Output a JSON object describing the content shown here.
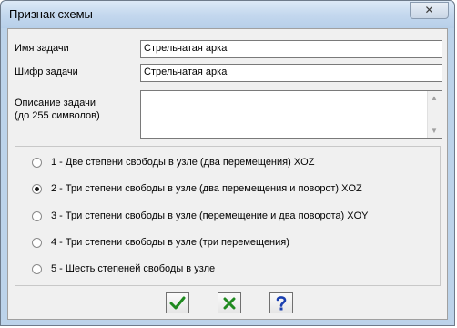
{
  "window": {
    "title": "Признак схемы",
    "close_glyph": "✕"
  },
  "form": {
    "task_name": {
      "label": "Имя задачи",
      "value": "Стрельчатая арка"
    },
    "task_code": {
      "label": "Шифр задачи",
      "value": "Стрельчатая арка"
    },
    "task_description": {
      "label_line1": "Описание задачи",
      "label_line2": "(до 255 символов)",
      "value": ""
    }
  },
  "scheme_options": {
    "selected_index": 1,
    "items": [
      {
        "label": "1 - Две степени свободы в узле (два перемещения) XOZ"
      },
      {
        "label": "2 - Три степени свободы в узле (два перемещения и поворот) XOZ"
      },
      {
        "label": "3 - Три степени свободы в узле (перемещение и два поворота) XOY"
      },
      {
        "label": "4 - Три степени свободы в узле (три перемещения)"
      },
      {
        "label": "5 - Шесть степеней свободы в узле"
      }
    ]
  },
  "buttons": {
    "ok_icon": "checkmark-icon",
    "cancel_icon": "x-icon",
    "help_icon": "question-icon",
    "colors": {
      "green": "#1f8a1f",
      "blue": "#1a3fb0"
    }
  }
}
